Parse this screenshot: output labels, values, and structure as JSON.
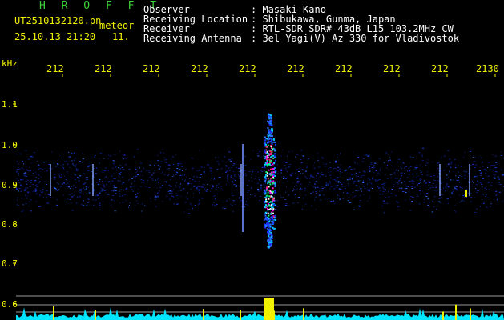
{
  "header": {
    "logo": "H R O F F T",
    "filename": "UT2510132120.pn",
    "type": "meteor",
    "datetime": "25.10.13 21:20",
    "count": "11.",
    "fields": [
      {
        "label": "Observer",
        "value": ": Masaki Kano"
      },
      {
        "label": "Receiving Location",
        "value": ": Shibukawa, Gunma, Japan"
      },
      {
        "label": "Receiver",
        "value": ": RTL-SDR SDR# 43dB L15 103.2MHz CW"
      },
      {
        "label": "Receiving Antenna",
        "value": ": 3el Yagi(V) Az 330 for Vladivostok"
      }
    ]
  },
  "axes": {
    "y_unit": "kHz",
    "y_ticks": [
      "1.1",
      "1.0",
      "0.9",
      "0.8",
      "0.7",
      "0.6"
    ],
    "x_ticks": [
      "212",
      "212",
      "212",
      "212",
      "212",
      "212",
      "212",
      "212",
      "212",
      "2130"
    ]
  },
  "colors": {
    "text": "#f2f200",
    "header": "#ffffff",
    "logo": "#3bd23b",
    "spectrum": "#00e5ff"
  }
}
